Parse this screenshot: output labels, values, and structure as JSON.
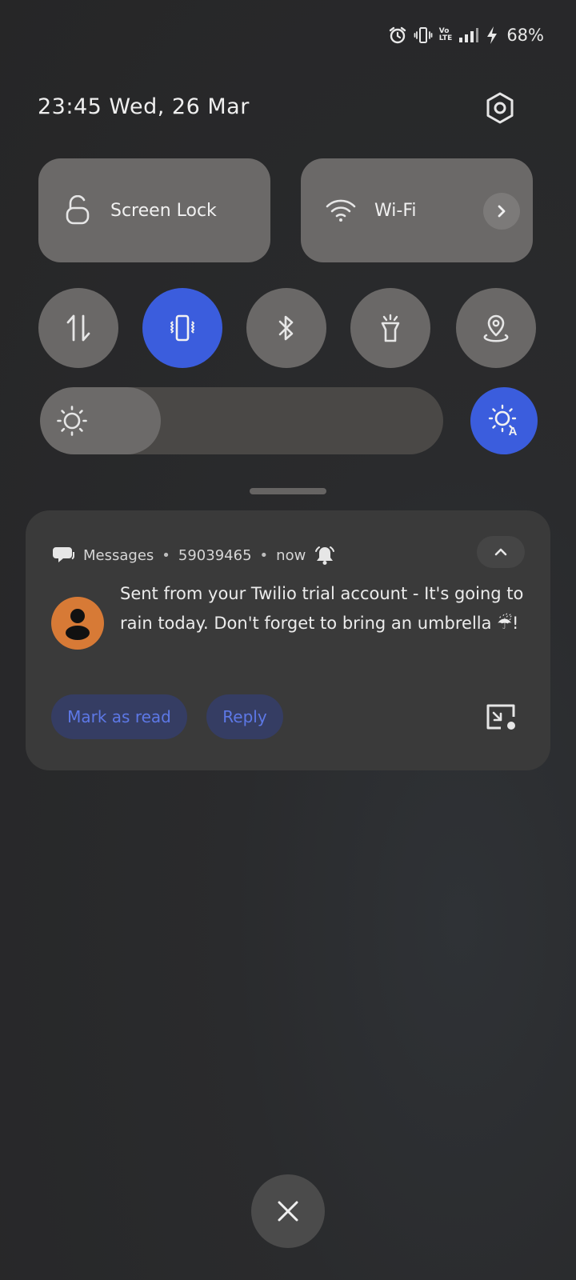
{
  "status_bar": {
    "icons": [
      "alarm-icon",
      "vibrate-icon",
      "volte-icon",
      "signal-icon",
      "charging-icon"
    ],
    "volte_line1": "Vo",
    "volte_line2": "LTE",
    "battery": "68%"
  },
  "header": {
    "datetime": "23:45  Wed, 26 Mar",
    "settings_icon": "settings-gear-icon"
  },
  "quick_settings": {
    "screen_lock_label": "Screen Lock",
    "wifi_label": "Wi-Fi",
    "toggles": [
      {
        "name": "mobile-data",
        "icon": "data-arrows-icon",
        "active": false
      },
      {
        "name": "vibrate",
        "icon": "vibrate-icon",
        "active": true
      },
      {
        "name": "bluetooth",
        "icon": "bluetooth-icon",
        "active": false
      },
      {
        "name": "flashlight",
        "icon": "flashlight-icon",
        "active": false
      },
      {
        "name": "location",
        "icon": "location-icon",
        "active": false
      }
    ],
    "brightness_level": 0.3,
    "auto_brightness_active": true
  },
  "notification": {
    "app": "Messages",
    "sender": "59039465",
    "time": "now",
    "separator": "•",
    "body": "Sent from your Twilio trial account - It's going to rain today. Don't forget to bring an umbrella ☔!",
    "actions": {
      "mark_read": "Mark as read",
      "reply": "Reply"
    }
  },
  "colors": {
    "accent": "#3b5ddd",
    "avatar": "#d77a36",
    "action_text": "#5d78e6"
  }
}
